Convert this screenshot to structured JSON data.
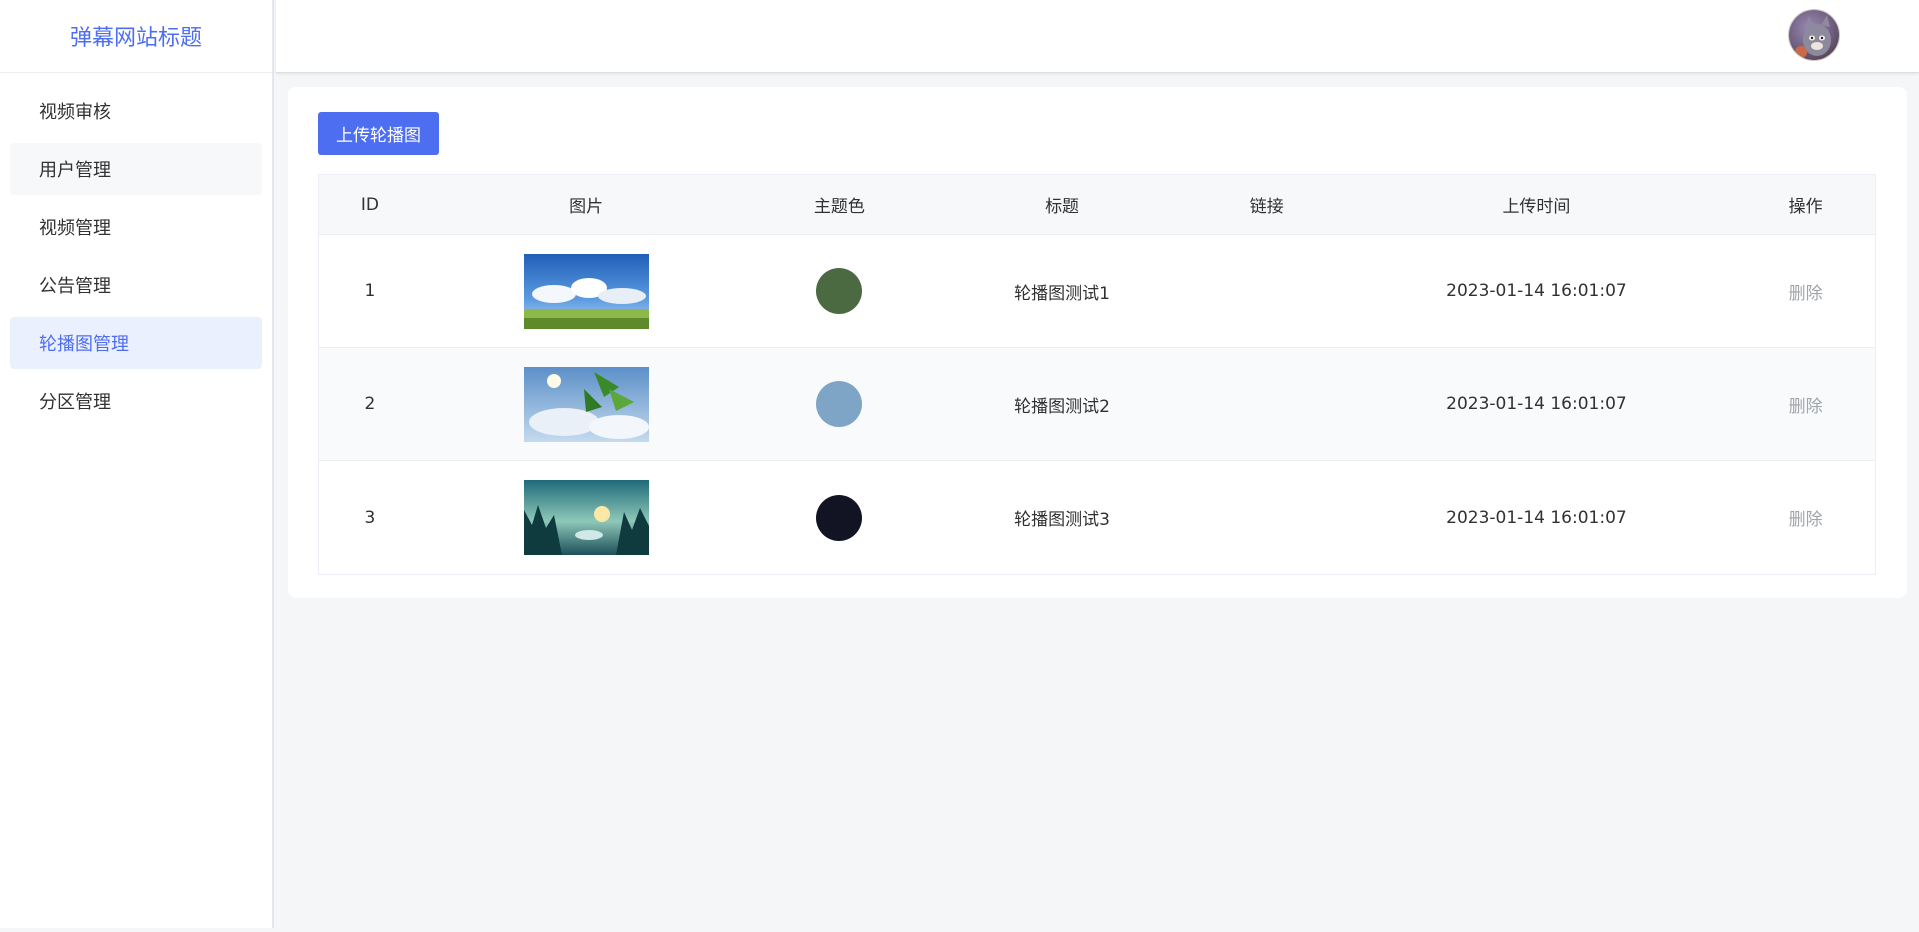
{
  "site_title": "弹幕网站标题",
  "sidebar": {
    "items": [
      {
        "label": "视频审核"
      },
      {
        "label": "用户管理"
      },
      {
        "label": "视频管理"
      },
      {
        "label": "公告管理"
      },
      {
        "label": "轮播图管理"
      },
      {
        "label": "分区管理"
      }
    ],
    "active_index": 4
  },
  "header": {
    "avatar_icon": "user-avatar"
  },
  "toolbar": {
    "upload_label": "上传轮播图"
  },
  "table": {
    "columns": [
      "ID",
      "图片",
      "主题色",
      "标题",
      "链接",
      "上传时间",
      "操作"
    ],
    "rows": [
      {
        "id": "1",
        "image": "sky-clouds-landscape",
        "color": "#4b6a42",
        "title": "轮播图测试1",
        "link": "",
        "time": "2023-01-14 16:01:07",
        "action": "删除"
      },
      {
        "id": "2",
        "image": "leaves-sky",
        "color": "#7fa5c6",
        "title": "轮播图测试2",
        "link": "",
        "time": "2023-01-14 16:01:07",
        "action": "删除"
      },
      {
        "id": "3",
        "image": "forest-lake-sunrise",
        "color": "#121424",
        "title": "轮播图测试3",
        "link": "",
        "time": "2023-01-14 16:01:07",
        "action": "删除"
      }
    ]
  },
  "colors": {
    "accent": "#4e6ef2",
    "active_bg": "#ebf0ff"
  }
}
